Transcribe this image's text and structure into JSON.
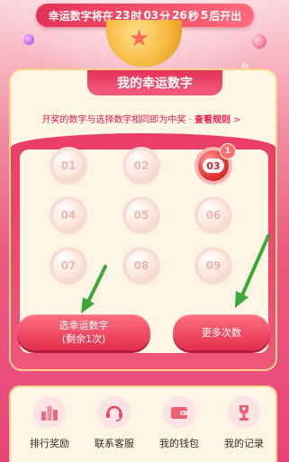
{
  "countdown": {
    "prefix": "幸运数字将在",
    "hours": "23",
    "hours_unit": "时",
    "minutes": "03",
    "minutes_unit": "分",
    "seconds": "26",
    "seconds_unit": "秒",
    "days": "5",
    "suffix": "后开出"
  },
  "panel": {
    "title": "我的幸运数字",
    "rule_text": "开奖的数字与选择数字相同即为中奖 · ",
    "rule_link": "查看规则",
    "rule_arrow": ">"
  },
  "numbers": [
    {
      "label": "01",
      "selected": false
    },
    {
      "label": "02",
      "selected": false
    },
    {
      "label": "03",
      "selected": true,
      "badge": "1"
    },
    {
      "label": "04",
      "selected": false
    },
    {
      "label": "05",
      "selected": false
    },
    {
      "label": "06",
      "selected": false
    },
    {
      "label": "07",
      "selected": false
    },
    {
      "label": "08",
      "selected": false
    },
    {
      "label": "09",
      "selected": false
    }
  ],
  "buttons": {
    "choose_label": "选幸运数字",
    "choose_sub": "(剩余1次)",
    "more_label": "更多次数"
  },
  "bottom_nav": [
    {
      "label": "排行奖励",
      "icon": "ranking-icon"
    },
    {
      "label": "联系客服",
      "icon": "headset-icon"
    },
    {
      "label": "我的钱包",
      "icon": "wallet-icon"
    },
    {
      "label": "我的记录",
      "icon": "trophy-record-icon"
    }
  ],
  "colors": {
    "accent_red": "#e43259",
    "panel_bg": "#fff5e4",
    "arrow_green": "#3aa93a"
  }
}
